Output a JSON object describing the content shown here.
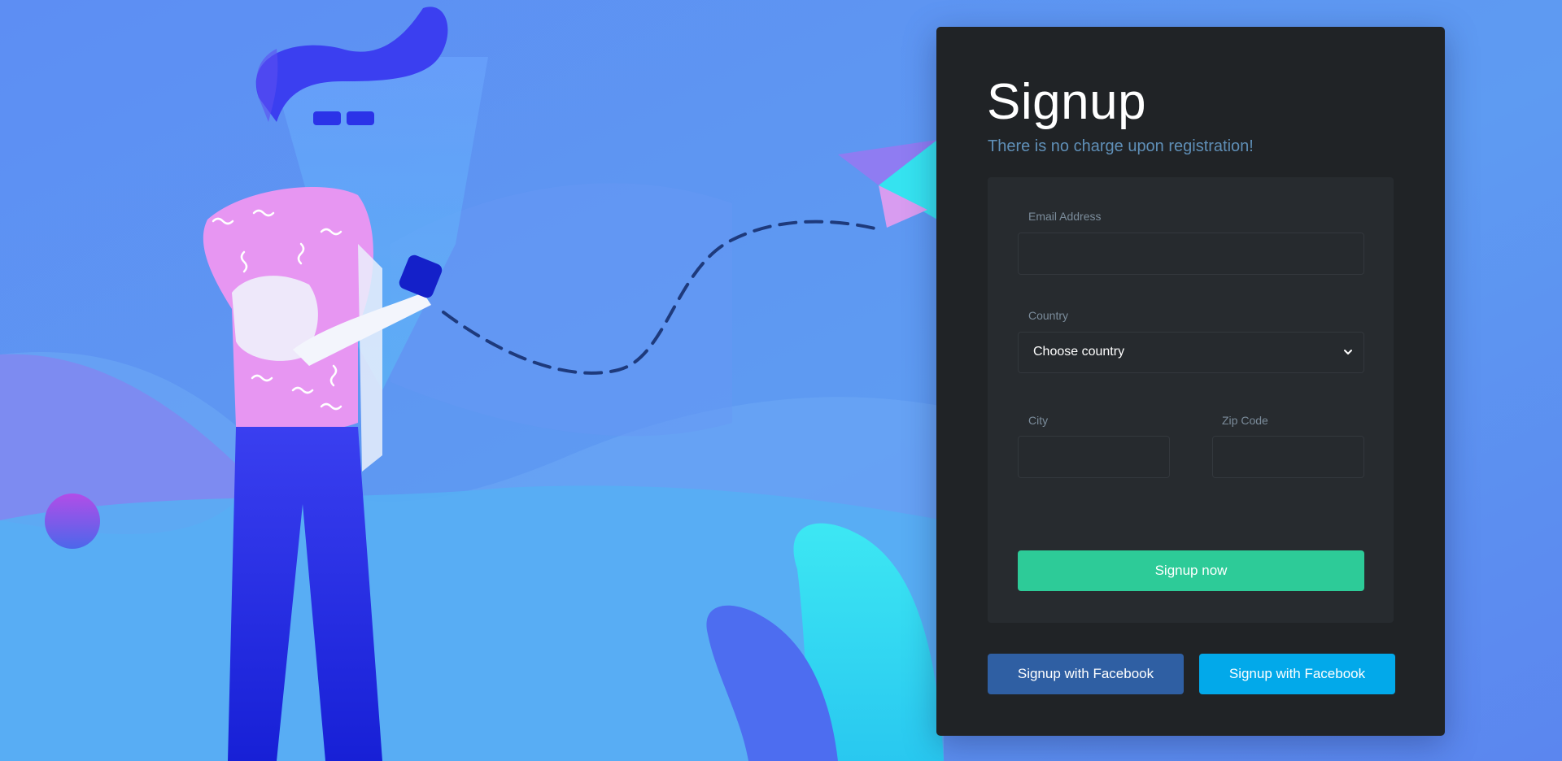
{
  "signup": {
    "title": "Signup",
    "subtitle": "There is no charge upon registration!"
  },
  "form": {
    "email": {
      "label": "Email Address",
      "value": ""
    },
    "country": {
      "label": "Country",
      "selected": "Choose country"
    },
    "city": {
      "label": "City",
      "value": ""
    },
    "zip": {
      "label": "Zip Code",
      "value": ""
    },
    "submit_label": "Signup now"
  },
  "social": {
    "facebook_label": "Signup with Facebook",
    "second_label": "Signup with Facebook"
  },
  "colors": {
    "card_bg": "#202326",
    "panel_bg": "#272b2f",
    "primary_button": "#2dcb98",
    "facebook_button": "#2f5fa3",
    "second_social_button": "#02a9ea",
    "background": "#5b8ef2"
  },
  "icons": {
    "select_arrow": "chevron-down-icon"
  }
}
